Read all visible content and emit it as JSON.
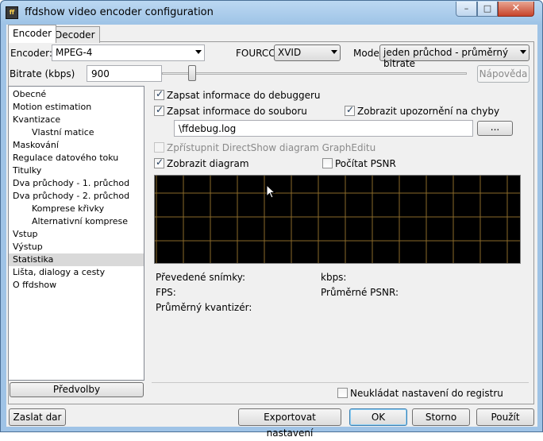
{
  "window": {
    "title": "ffdshow video encoder configuration",
    "icon": "ffdshow-app-icon",
    "controls": {
      "minimize": "–",
      "maximize": "□",
      "close": "✕"
    }
  },
  "tabs": [
    {
      "label": "Encoder",
      "active": true
    },
    {
      "label": "Decoder",
      "active": false
    }
  ],
  "encoder_row": {
    "encoder_label": "Encoder:",
    "encoder_value": "MPEG-4",
    "fourcc_label": "FOURCC:",
    "fourcc_value": "XVID",
    "mode_label": "Mode:",
    "mode_value": "jeden průchod - průměrný bitrate"
  },
  "bitrate_row": {
    "label": "Bitrate (kbps)",
    "value": "900",
    "slider_fraction": 0.1,
    "help_button": "Nápověda"
  },
  "tree": {
    "items": [
      {
        "label": "Obecné",
        "indent": 0,
        "selected": false
      },
      {
        "label": "Motion estimation",
        "indent": 0,
        "selected": false
      },
      {
        "label": "Kvantizace",
        "indent": 0,
        "selected": false
      },
      {
        "label": "Vlastní matice",
        "indent": 1,
        "selected": false
      },
      {
        "label": "Maskování",
        "indent": 0,
        "selected": false
      },
      {
        "label": "Regulace datového toku",
        "indent": 0,
        "selected": false
      },
      {
        "label": "Titulky",
        "indent": 0,
        "selected": false
      },
      {
        "label": "Dva průchody - 1. průchod",
        "indent": 0,
        "selected": false
      },
      {
        "label": "Dva průchody - 2. průchod",
        "indent": 0,
        "selected": false
      },
      {
        "label": "Komprese křivky",
        "indent": 1,
        "selected": false
      },
      {
        "label": "Alternativní komprese",
        "indent": 1,
        "selected": false
      },
      {
        "label": "Vstup",
        "indent": 0,
        "selected": false
      },
      {
        "label": "Výstup",
        "indent": 0,
        "selected": false
      },
      {
        "label": "Statistika",
        "indent": 0,
        "selected": true
      },
      {
        "label": "Lišta, dialogy a cesty",
        "indent": 0,
        "selected": false
      },
      {
        "label": "O ffdshow",
        "indent": 0,
        "selected": false
      }
    ],
    "presets_button": "Předvolby"
  },
  "stats": {
    "debugger_label": "Zapsat informace do debuggeru",
    "debugger_checked": true,
    "file_label": "Zapsat informace do souboru",
    "file_checked": true,
    "warnings_label": "Zobrazit upozornění na chyby",
    "warnings_checked": true,
    "file_path": "\\ffdebug.log",
    "browse_button": "...",
    "graphedit_label": "Zpřístupnit DirectShow diagram GraphEditu",
    "graphedit_checked": false,
    "diagram_label": "Zobrazit diagram",
    "diagram_checked": true,
    "psnr_label": "Počítat PSNR",
    "psnr_checked": false,
    "frames_label": "Převedené snímky:",
    "kbps_label": "kbps:",
    "fps_label": "FPS:",
    "avg_psnr_label": "Průměrné PSNR:",
    "avg_quant_label": "Průměrný kvantizér:",
    "grid_color": "#8a6a2a"
  },
  "registry": {
    "label": "Neukládat nastavení do registru",
    "checked": false
  },
  "bottom_buttons": {
    "donate": "Zaslat dar",
    "export": "Exportovat nastavení",
    "ok": "OK",
    "cancel": "Storno",
    "apply": "Použít"
  }
}
